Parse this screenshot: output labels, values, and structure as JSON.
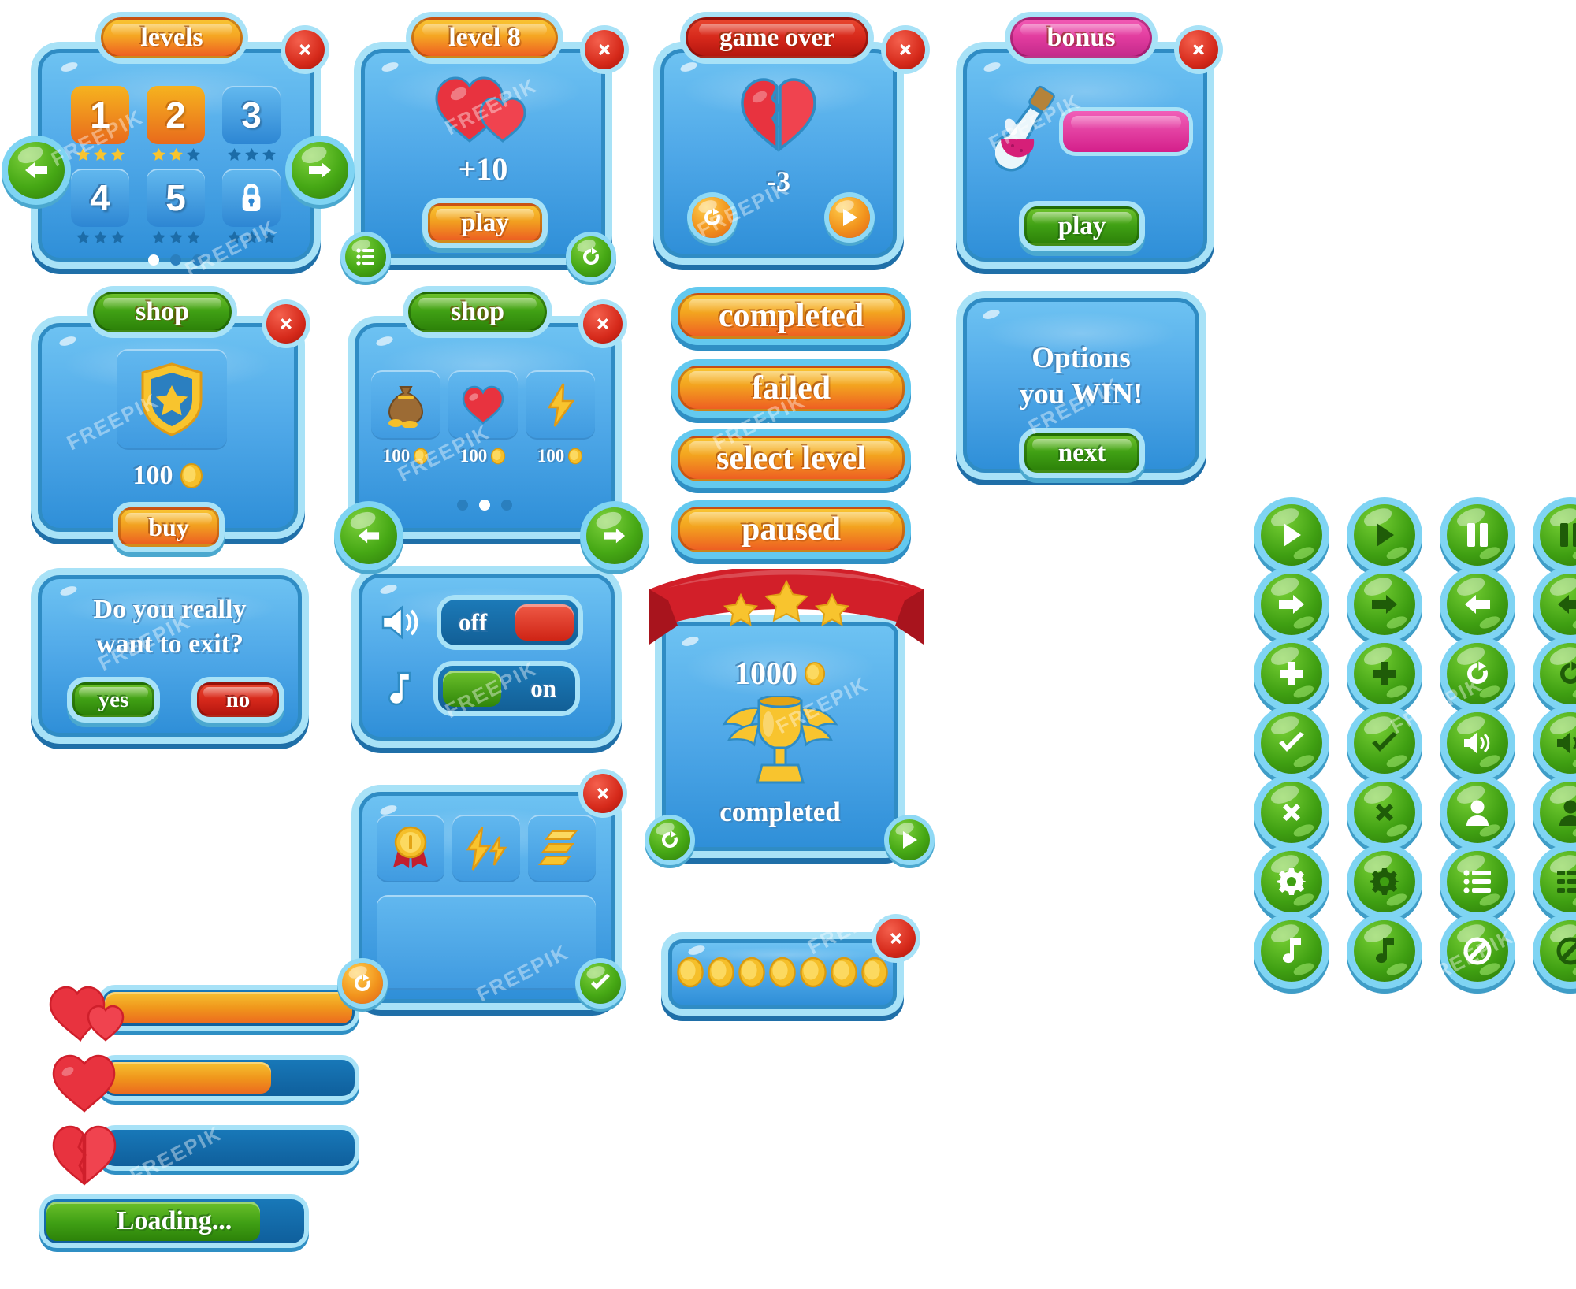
{
  "watermark": "FREEPIK",
  "colors": {
    "panel_blue": "#4fa8e8",
    "panel_border": "#2f8cc4",
    "panel_glow": "#a8e2f7",
    "orange": "#f2a020",
    "red": "#d6281b",
    "green": "#3f9f14",
    "pink": "#e13b9e",
    "gold": "#f5bf2a"
  },
  "levels_panel": {
    "title": "levels",
    "close_label": "✖",
    "tiles": [
      {
        "label": "1",
        "state": "unlocked-active",
        "stars_filled": 3
      },
      {
        "label": "2",
        "state": "unlocked-active",
        "stars_filled": 2
      },
      {
        "label": "3",
        "state": "unlocked",
        "stars_filled": 0
      },
      {
        "label": "4",
        "state": "unlocked",
        "stars_filled": 0
      },
      {
        "label": "5",
        "state": "unlocked",
        "stars_filled": 0
      },
      {
        "label": "🔒",
        "state": "locked",
        "stars_filled": 0
      }
    ],
    "pager": {
      "count": 3,
      "active_index": 0
    }
  },
  "level8_panel": {
    "title": "level 8",
    "close_label": "✖",
    "reward": "+10",
    "play_label": "play",
    "icon": "double-heart"
  },
  "gameover_panel": {
    "title": "game over",
    "close_label": "✖",
    "penalty": "-3",
    "icon": "broken-heart"
  },
  "bonus_panel": {
    "title": "bonus",
    "close_label": "✖",
    "play_label": "play",
    "icon": "potion-flask"
  },
  "shop_single_panel": {
    "title": "shop",
    "close_label": "✖",
    "item_icon": "shield-star",
    "price": "100",
    "buy_label": "buy"
  },
  "shop_multi_panel": {
    "title": "shop",
    "close_label": "✖",
    "items": [
      {
        "icon": "money-bag",
        "price": "100"
      },
      {
        "icon": "heart",
        "price": "100"
      },
      {
        "icon": "lightning",
        "price": "100"
      }
    ],
    "pager": {
      "count": 3,
      "active_index": 1
    }
  },
  "status_buttons": [
    {
      "label": "completed"
    },
    {
      "label": "failed"
    },
    {
      "label": "select level"
    },
    {
      "label": "paused"
    }
  ],
  "options_panel": {
    "line1": "Options",
    "line2": "you WIN!",
    "next_label": "next"
  },
  "exit_panel": {
    "line1": "Do you really",
    "line2": "want to exit?",
    "yes_label": "yes",
    "no_label": "no"
  },
  "settings_panel": {
    "rows": [
      {
        "icon": "sound-icon",
        "value": "off",
        "state": "off"
      },
      {
        "icon": "music-note-icon",
        "value": "on",
        "state": "on"
      }
    ]
  },
  "trophy_panel": {
    "stars": 3,
    "score": "1000",
    "status": "completed",
    "icon": "winged-trophy"
  },
  "loading_panel": {
    "bars": [
      {
        "icon": "double-heart",
        "fill_percent": 100
      },
      {
        "icon": "heart",
        "fill_percent": 66
      },
      {
        "icon": "broken-heart",
        "fill_percent": 0
      }
    ],
    "loading_label": "Loading...",
    "loading_fill_percent": 82
  },
  "achievements_panel": {
    "close_label": "✖",
    "slots": [
      {
        "icon": "medal-icon"
      },
      {
        "icon": "lightning-icon"
      },
      {
        "icon": "gold-bar-icon"
      }
    ]
  },
  "coins_panel": {
    "close_label": "✖",
    "coin_count": 7
  },
  "icon_grid": {
    "rows": [
      [
        {
          "name": "play-icon",
          "variant": "light"
        },
        {
          "name": "play-icon",
          "variant": "dark"
        },
        {
          "name": "pause-icon",
          "variant": "light"
        },
        {
          "name": "pause-icon",
          "variant": "dark"
        }
      ],
      [
        {
          "name": "arrow-right-icon",
          "variant": "light"
        },
        {
          "name": "arrow-right-icon",
          "variant": "dark"
        },
        {
          "name": "arrow-left-icon",
          "variant": "light"
        },
        {
          "name": "arrow-left-icon",
          "variant": "dark"
        }
      ],
      [
        {
          "name": "plus-icon",
          "variant": "light"
        },
        {
          "name": "plus-icon",
          "variant": "dark"
        },
        {
          "name": "refresh-icon",
          "variant": "light"
        },
        {
          "name": "refresh-icon",
          "variant": "dark"
        }
      ],
      [
        {
          "name": "check-icon",
          "variant": "light"
        },
        {
          "name": "check-icon",
          "variant": "dark"
        },
        {
          "name": "sound-on-icon",
          "variant": "light"
        },
        {
          "name": "sound-on-icon",
          "variant": "dark"
        }
      ],
      [
        {
          "name": "close-icon",
          "variant": "light"
        },
        {
          "name": "close-icon",
          "variant": "dark"
        },
        {
          "name": "user-icon",
          "variant": "light"
        },
        {
          "name": "user-icon",
          "variant": "dark"
        }
      ],
      [
        {
          "name": "gear-icon",
          "variant": "light"
        },
        {
          "name": "gear-icon",
          "variant": "dark"
        },
        {
          "name": "list-icon",
          "variant": "light"
        },
        {
          "name": "grid-icon",
          "variant": "dark"
        }
      ],
      [
        {
          "name": "music-note-icon",
          "variant": "light"
        },
        {
          "name": "music-note-icon",
          "variant": "dark"
        },
        {
          "name": "block-icon",
          "variant": "light"
        },
        {
          "name": "block-icon",
          "variant": "dark"
        }
      ]
    ]
  }
}
